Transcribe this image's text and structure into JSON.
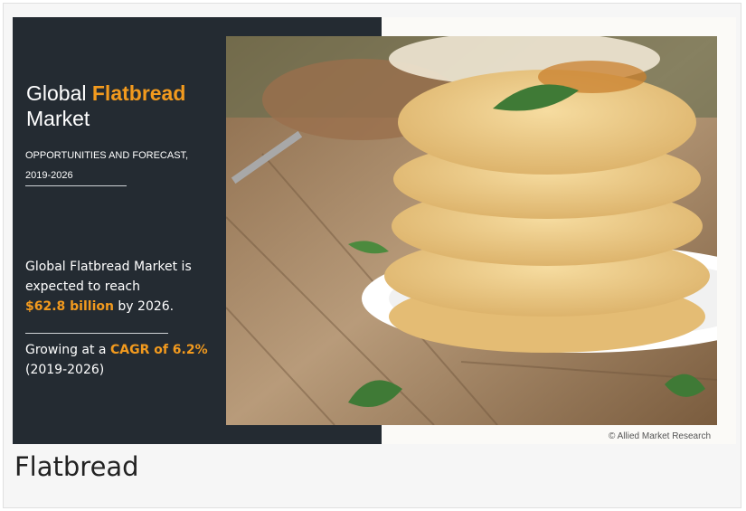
{
  "infographic": {
    "title_prefix": "Global ",
    "title_accent": "Flatbread",
    "title_line2": "Market",
    "subtitle": "OPPORTUNITIES AND FORECAST, 2019-2026",
    "reach_text_1": "Global Flatbread Market is expected to reach",
    "reach_value": "$62.8 billion",
    "reach_text_2": " by 2026.",
    "growth_prefix": "Growing at a ",
    "growth_value": "CAGR of 6.2%",
    "growth_period": "(2019-2026)",
    "credit": "© Allied Market Research"
  },
  "caption": "Flatbread",
  "colors": {
    "panel": "#242b32",
    "accent": "#f29a1e"
  }
}
